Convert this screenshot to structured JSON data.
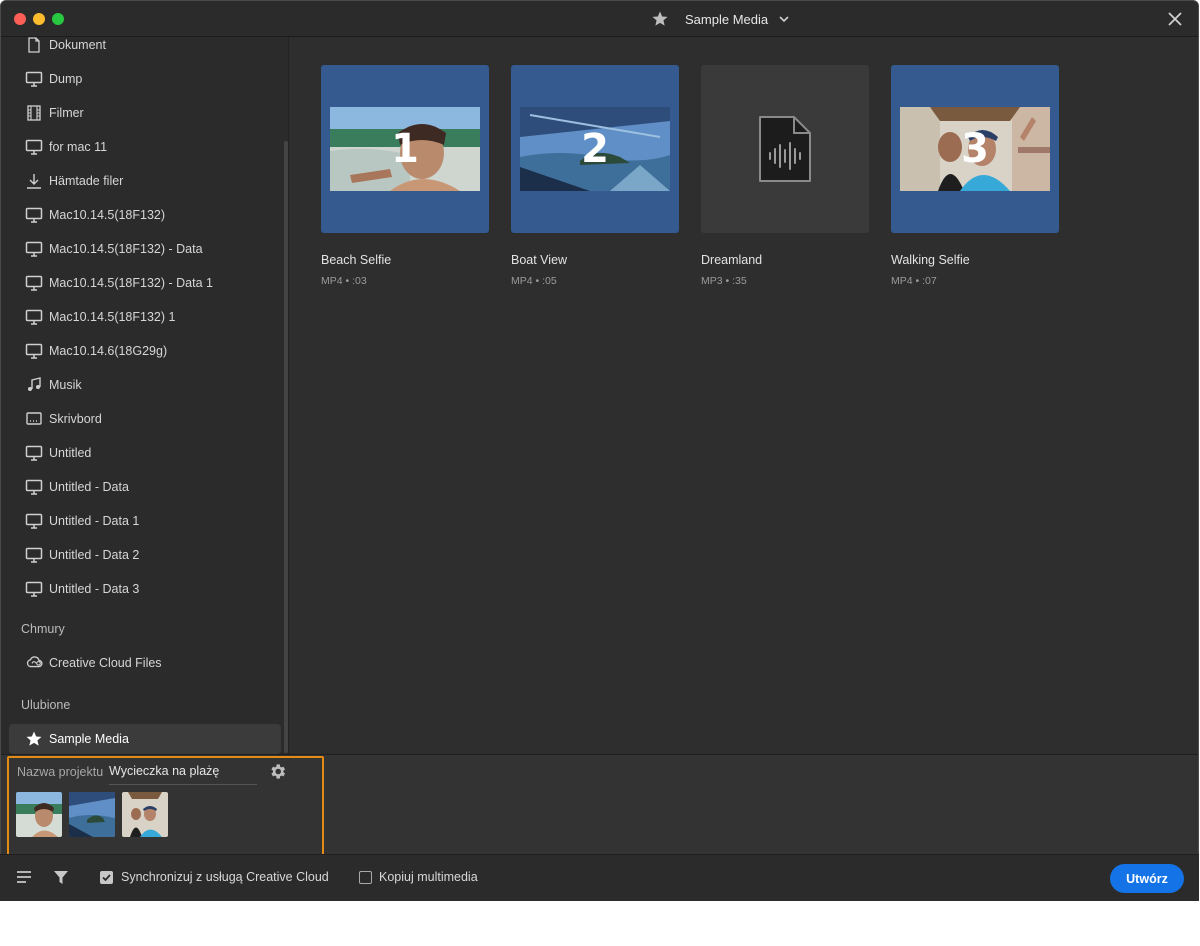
{
  "window": {
    "title": "Sample Media"
  },
  "sidebar": {
    "items": [
      {
        "label": "Dokument",
        "icon": "document-icon"
      },
      {
        "label": "Dump",
        "icon": "monitor-icon"
      },
      {
        "label": "Filmer",
        "icon": "film-icon"
      },
      {
        "label": "for mac 11",
        "icon": "monitor-icon"
      },
      {
        "label": "Hämtade filer",
        "icon": "download-icon"
      },
      {
        "label": "Mac10.14.5(18F132)",
        "icon": "monitor-icon"
      },
      {
        "label": "Mac10.14.5(18F132) - Data",
        "icon": "monitor-icon"
      },
      {
        "label": "Mac10.14.5(18F132) - Data 1",
        "icon": "monitor-icon"
      },
      {
        "label": "Mac10.14.5(18F132) 1",
        "icon": "monitor-icon"
      },
      {
        "label": "Mac10.14.6(18G29g)",
        "icon": "monitor-icon"
      },
      {
        "label": "Musik",
        "icon": "music-note-icon"
      },
      {
        "label": "Skrivbord",
        "icon": "desktop-icon"
      },
      {
        "label": "Untitled",
        "icon": "monitor-icon"
      },
      {
        "label": "Untitled - Data",
        "icon": "monitor-icon"
      },
      {
        "label": "Untitled - Data 1",
        "icon": "monitor-icon"
      },
      {
        "label": "Untitled - Data 2",
        "icon": "monitor-icon"
      },
      {
        "label": "Untitled - Data 3",
        "icon": "monitor-icon"
      }
    ],
    "clouds_heading": "Chmury",
    "cloud_item": {
      "label": "Creative Cloud Files",
      "icon": "creative-cloud-icon"
    },
    "favorites_heading": "Ulubione",
    "favorite_item": {
      "label": "Sample Media",
      "icon": "star-icon"
    }
  },
  "media": [
    {
      "title": "Beach Selfie",
      "meta": "MP4 • :03",
      "badge": "1",
      "kind": "video"
    },
    {
      "title": "Boat View",
      "meta": "MP4 • :05",
      "badge": "2",
      "kind": "video"
    },
    {
      "title": "Dreamland",
      "meta": "MP3 • :35",
      "badge": "",
      "kind": "audio"
    },
    {
      "title": "Walking Selfie",
      "meta": "MP4 • :07",
      "badge": "3",
      "kind": "video"
    }
  ],
  "project": {
    "label": "Nazwa projektu",
    "name": "Wycieczka na plażę"
  },
  "footer": {
    "sync_label": "Synchronizuj z usługą Creative Cloud",
    "sync_checked": true,
    "copy_label": "Kopiuj multimedia",
    "copy_checked": false,
    "create_label": "Utwórz"
  },
  "colors": {
    "accent": "#1473e6",
    "selection_outline": "#e38b14",
    "thumb_selected": "#355a8f"
  }
}
